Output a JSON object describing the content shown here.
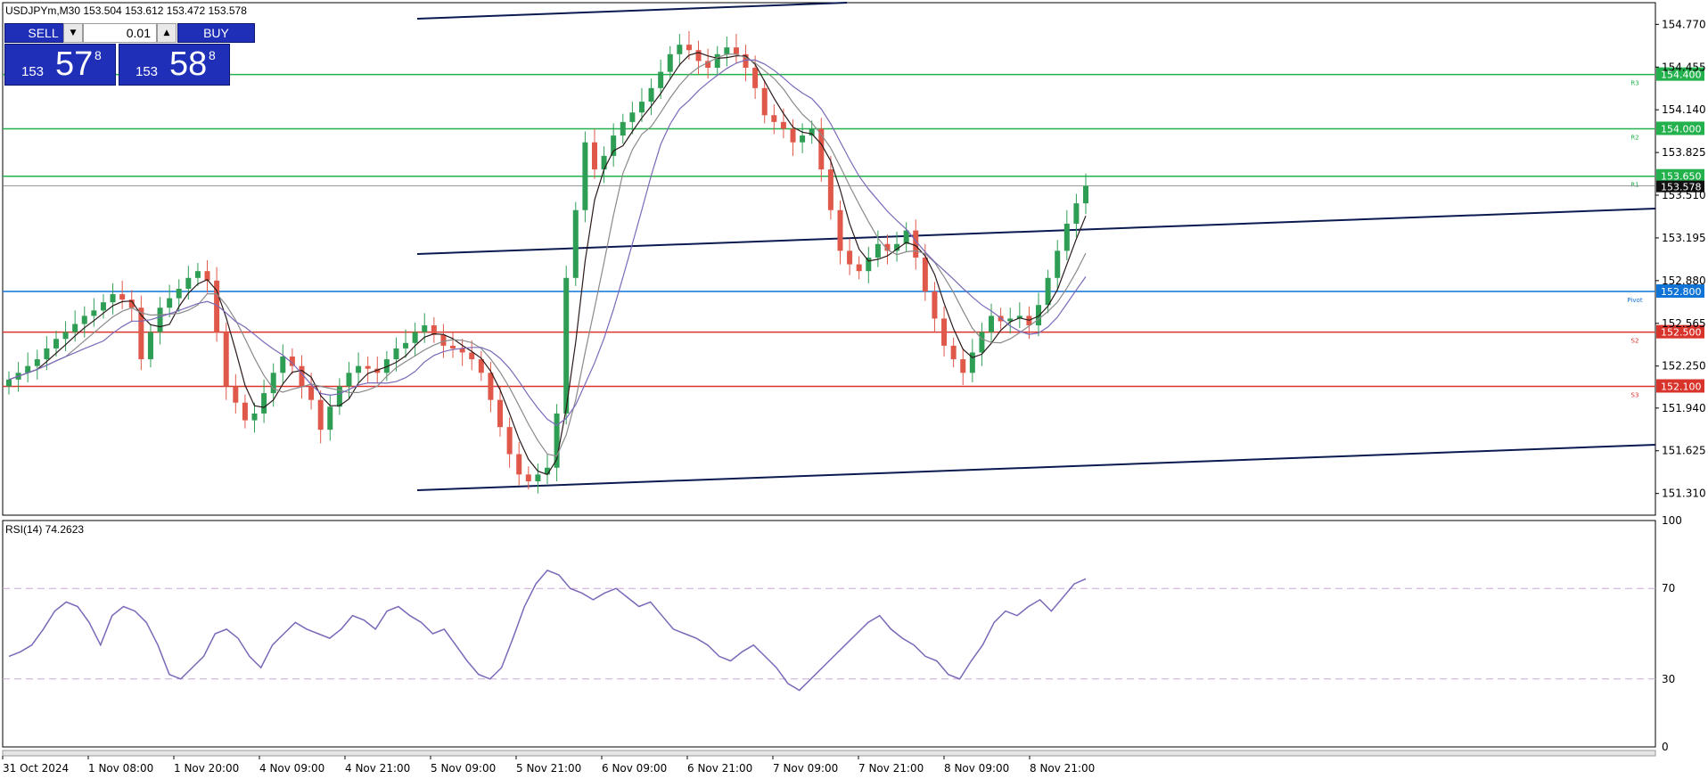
{
  "header": {
    "symbol_info": "USDJPYm,M30  153.504 153.612 153.472 153.578"
  },
  "trade_panel": {
    "sell_label": "SELL",
    "buy_label": "BUY",
    "lot_value": "0.01",
    "sell_price_prefix": "153",
    "sell_price_big": "57",
    "sell_price_sup": "8",
    "buy_price_prefix": "153",
    "buy_price_big": "58",
    "buy_price_sup": "8"
  },
  "chart_data": [
    {
      "type": "line",
      "chart": "USDJPYm M30 candlestick price chart",
      "yaxis": {
        "ticks": [
          "154.770",
          "154.455",
          "154.140",
          "153.825",
          "153.510",
          "153.195",
          "152.880",
          "152.565",
          "152.250",
          "151.940",
          "151.625",
          "151.310"
        ],
        "range": [
          151.15,
          154.93
        ]
      },
      "xaxis": {
        "ticks": [
          "31 Oct 2024",
          "1 Nov 08:00",
          "1 Nov 20:00",
          "4 Nov 09:00",
          "4 Nov 21:00",
          "5 Nov 09:00",
          "5 Nov 21:00",
          "6 Nov 09:00",
          "6 Nov 21:00",
          "7 Nov 09:00",
          "7 Nov 21:00",
          "8 Nov 09:00",
          "8 Nov 21:00"
        ]
      },
      "levels": [
        {
          "value": 154.4,
          "label": "154.400",
          "tag": "R3",
          "color": "#22b14c"
        },
        {
          "value": 154.0,
          "label": "154.000",
          "tag": "R2",
          "color": "#22b14c"
        },
        {
          "value": 153.65,
          "label": "153.650",
          "tag": "R1",
          "color": "#22b14c"
        },
        {
          "value": 152.8,
          "label": "152.800",
          "tag": "Pivot",
          "color": "#0f74d6"
        },
        {
          "value": 152.5,
          "label": "152.500",
          "tag": "S2",
          "color": "#d9342b"
        },
        {
          "value": 152.1,
          "label": "152.100",
          "tag": "S3",
          "color": "#d9342b"
        }
      ],
      "current_price": {
        "value": 153.578,
        "label": "153.578"
      },
      "series_close": [
        152.15,
        152.2,
        152.25,
        152.3,
        152.38,
        152.45,
        152.5,
        152.56,
        152.62,
        152.66,
        152.72,
        152.78,
        152.74,
        152.68,
        152.3,
        152.5,
        152.68,
        152.75,
        152.82,
        152.9,
        152.95,
        152.88,
        152.5,
        152.1,
        151.98,
        151.85,
        151.9,
        152.05,
        152.2,
        152.32,
        152.25,
        152.1,
        152.0,
        151.78,
        151.95,
        152.1,
        152.2,
        152.25,
        152.23,
        152.2,
        152.3,
        152.38,
        152.42,
        152.5,
        152.55,
        152.48,
        152.4,
        152.38,
        152.35,
        152.3,
        152.2,
        152.0,
        151.8,
        151.6,
        151.45,
        151.4,
        151.45,
        151.5,
        151.9,
        152.9,
        153.4,
        153.9,
        153.7,
        153.8,
        153.95,
        154.05,
        154.12,
        154.2,
        154.3,
        154.42,
        154.55,
        154.62,
        154.58,
        154.5,
        154.45,
        154.55,
        154.6,
        154.55,
        154.45,
        154.3,
        154.1,
        154.05,
        154.0,
        153.9,
        153.95,
        154.0,
        153.7,
        153.4,
        153.1,
        153.0,
        152.95,
        153.05,
        153.15,
        153.1,
        153.15,
        153.25,
        153.05,
        152.8,
        152.6,
        152.4,
        152.3,
        152.2,
        152.35,
        152.5,
        152.62,
        152.58,
        152.6,
        152.62,
        152.55,
        152.7,
        152.9,
        153.1,
        153.3,
        153.45,
        153.58
      ],
      "indicators": [
        "moving average (dark)",
        "moving average (grey)",
        "moving average (purple)",
        "regression channel (dark blue)"
      ]
    },
    {
      "type": "line",
      "chart": "RSI panel",
      "title": "RSI(14) 74.2623",
      "yaxis": {
        "ticks": [
          "100",
          "70",
          "30",
          "0"
        ],
        "range": [
          0,
          100
        ]
      },
      "levels": [
        70,
        30
      ],
      "color": "#7b68b8",
      "series_rsi": [
        40,
        42,
        45,
        52,
        60,
        64,
        62,
        55,
        45,
        58,
        62,
        60,
        55,
        45,
        32,
        30,
        35,
        40,
        50,
        52,
        48,
        40,
        35,
        45,
        50,
        55,
        52,
        50,
        48,
        52,
        58,
        56,
        52,
        60,
        62,
        58,
        55,
        50,
        52,
        45,
        38,
        32,
        30,
        35,
        48,
        62,
        72,
        78,
        76,
        70,
        68,
        65,
        68,
        70,
        66,
        62,
        64,
        58,
        52,
        50,
        48,
        45,
        40,
        38,
        42,
        45,
        40,
        35,
        28,
        25,
        30,
        35,
        40,
        45,
        50,
        55,
        58,
        52,
        48,
        45,
        40,
        38,
        32,
        30,
        38,
        45,
        55,
        60,
        58,
        62,
        65,
        60,
        66,
        72,
        74.26
      ]
    }
  ]
}
